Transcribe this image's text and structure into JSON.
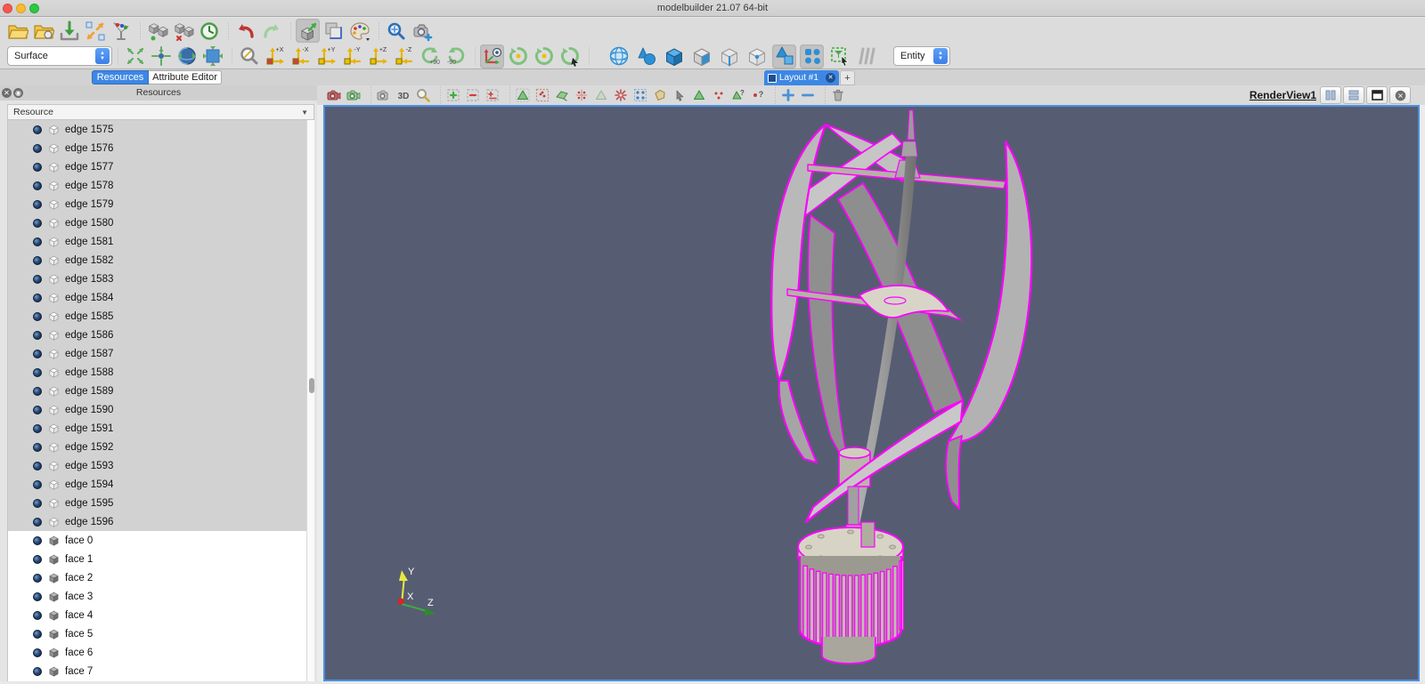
{
  "window": {
    "title": "modelbuilder 21.07 64-bit"
  },
  "toolbar_main": {
    "icons": [
      "open-folder",
      "recent-folder",
      "save-data",
      "reset-view",
      "color-legend",
      "cube-pair-green",
      "cube-pair-red",
      "history-clock",
      "undo",
      "redo",
      "camera-move-toggle",
      "display-scale",
      "color-palette",
      "zoom-select",
      "camera-plus"
    ]
  },
  "toolbar_view": {
    "representation_combo": "Surface",
    "entity_combo": "Entity",
    "icons_fit": [
      "expand-arrows",
      "center-arrows",
      "sphere-arrows",
      "box-arrows"
    ],
    "icons_zoom": [
      "zoom-box"
    ],
    "icons_axis": [
      "plus-x",
      "minus-x",
      "plus-y",
      "minus-y",
      "plus-z",
      "minus-z",
      "rotate-plus-90",
      "rotate-minus-90"
    ],
    "rotate_labels": {
      "plus": "+90",
      "minus": "-90"
    },
    "axis_labels": [
      "+X",
      "-X",
      "+Y",
      "-Y",
      "+Z",
      "-Z"
    ],
    "icons_camera": [
      "axes-eye-toggle",
      "orbit-1",
      "orbit-2",
      "orbit-cursor"
    ],
    "icons_blue": [
      "sphere-grid",
      "cone-sphere",
      "cube-solid",
      "cube-face",
      "cube-edge",
      "cube-vertex",
      "cone-square-toggle",
      "dots-four-toggle",
      "select-filter",
      "slashes"
    ]
  },
  "panel_tabs": [
    {
      "label": "Resources",
      "active": true
    },
    {
      "label": "Attribute Editor",
      "active": false
    }
  ],
  "layout_tab": {
    "label": "Layout #1",
    "add_label": "+"
  },
  "left_panel": {
    "header": "Resources",
    "tree_header": "Resource",
    "items": [
      {
        "label": "edge 1575",
        "type": "edge",
        "selected": true
      },
      {
        "label": "edge 1576",
        "type": "edge",
        "selected": true
      },
      {
        "label": "edge 1577",
        "type": "edge",
        "selected": true
      },
      {
        "label": "edge 1578",
        "type": "edge",
        "selected": true
      },
      {
        "label": "edge 1579",
        "type": "edge",
        "selected": true
      },
      {
        "label": "edge 1580",
        "type": "edge",
        "selected": true
      },
      {
        "label": "edge 1581",
        "type": "edge",
        "selected": true
      },
      {
        "label": "edge 1582",
        "type": "edge",
        "selected": true
      },
      {
        "label": "edge 1583",
        "type": "edge",
        "selected": true
      },
      {
        "label": "edge 1584",
        "type": "edge",
        "selected": true
      },
      {
        "label": "edge 1585",
        "type": "edge",
        "selected": true
      },
      {
        "label": "edge 1586",
        "type": "edge",
        "selected": true
      },
      {
        "label": "edge 1587",
        "type": "edge",
        "selected": true
      },
      {
        "label": "edge 1588",
        "type": "edge",
        "selected": true
      },
      {
        "label": "edge 1589",
        "type": "edge",
        "selected": true
      },
      {
        "label": "edge 1590",
        "type": "edge",
        "selected": true
      },
      {
        "label": "edge 1591",
        "type": "edge",
        "selected": true
      },
      {
        "label": "edge 1592",
        "type": "edge",
        "selected": true
      },
      {
        "label": "edge 1593",
        "type": "edge",
        "selected": true
      },
      {
        "label": "edge 1594",
        "type": "edge",
        "selected": true
      },
      {
        "label": "edge 1595",
        "type": "edge",
        "selected": true
      },
      {
        "label": "edge 1596",
        "type": "edge",
        "selected": true
      },
      {
        "label": "face 0",
        "type": "face",
        "selected": false
      },
      {
        "label": "face 1",
        "type": "face",
        "selected": false
      },
      {
        "label": "face 2",
        "type": "face",
        "selected": false
      },
      {
        "label": "face 3",
        "type": "face",
        "selected": false
      },
      {
        "label": "face 4",
        "type": "face",
        "selected": false
      },
      {
        "label": "face 5",
        "type": "face",
        "selected": false
      },
      {
        "label": "face 6",
        "type": "face",
        "selected": false
      },
      {
        "label": "face 7",
        "type": "face",
        "selected": false
      }
    ]
  },
  "render_view": {
    "label": "RenderView1",
    "toolbar_icons": [
      "camera-red",
      "camera-export",
      "camera-gray",
      "label-3d",
      "zoom-magnify",
      "box-plus",
      "box-minus",
      "box-pm",
      "tri-add",
      "pt-select",
      "surface-select",
      "pts-arrows",
      "tri-faded",
      "star-red",
      "pts-blue",
      "poly-beige",
      "cursor-small",
      "tri-green2",
      "pts-red2",
      "tri-question",
      "pt-question",
      "plus-blue",
      "minus-blue",
      "trash"
    ],
    "window_buttons": [
      "split-horizontal",
      "split-vertical",
      "maximize",
      "close"
    ],
    "axes": {
      "x": "X",
      "y": "Y",
      "z": "Z"
    }
  },
  "colors": {
    "selection_highlight": "#ff00ff",
    "viewport_bg": "#565d72",
    "accent_blue": "#3d87e4"
  }
}
